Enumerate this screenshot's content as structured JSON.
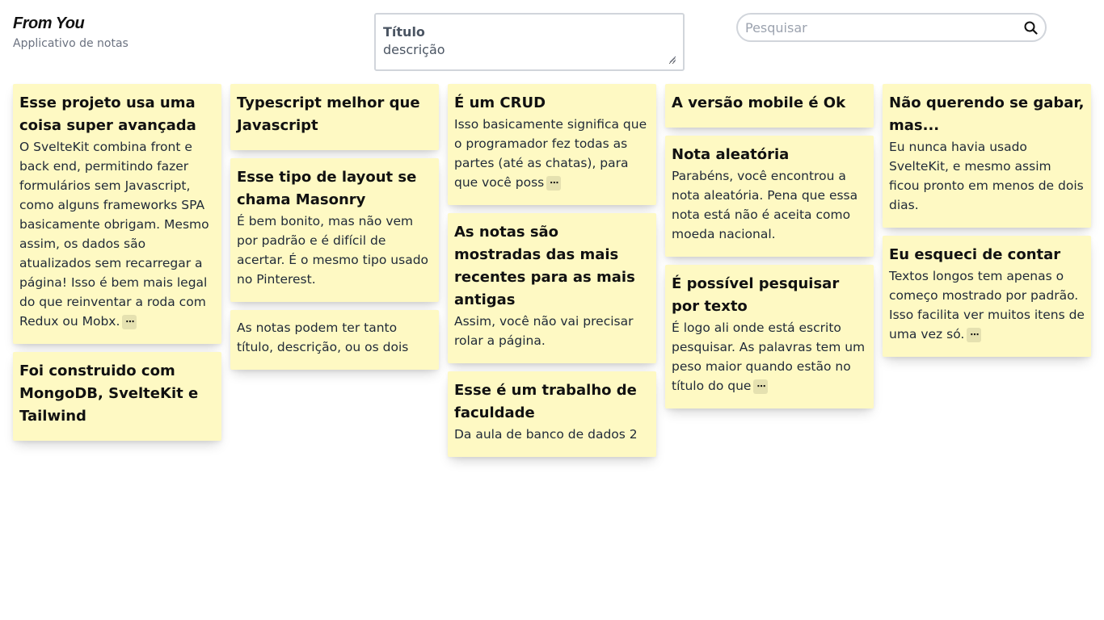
{
  "brand": {
    "title": "From You",
    "subtitle": "Applicativo de notas"
  },
  "composer": {
    "title_placeholder": "Título",
    "desc_placeholder": "descrição"
  },
  "search": {
    "placeholder": "Pesquisar",
    "icon": "search-icon"
  },
  "more_label": "⋯",
  "columns": [
    [
      {
        "title": "Esse projeto usa uma coisa super avançada",
        "desc": "O SvelteKit combina front e back end, permitindo fazer formulários sem Javascript, como alguns frameworks SPA basicamente obrigam. Mesmo assim, os dados são atualizados sem recarregar a página! Isso é bem mais legal do que reinventar a roda com Redux ou Mobx.",
        "truncated": true
      },
      {
        "title": "Foi construido com MongoDB, SvelteKit e Tailwind",
        "desc": "",
        "truncated": false
      }
    ],
    [
      {
        "title": "Typescript melhor que Javascript",
        "desc": "",
        "truncated": false
      },
      {
        "title": "Esse tipo de layout se chama Masonry",
        "desc": "É bem bonito, mas não vem por padrão e é difícil de acertar. É o mesmo tipo usado no Pinterest.",
        "truncated": false
      },
      {
        "title": "",
        "desc": "As notas podem ter tanto título, descrição, ou os dois",
        "truncated": false
      }
    ],
    [
      {
        "title": "É um CRUD",
        "desc": "Isso basicamente significa que o programador fez todas as partes (até as chatas), para que você poss",
        "truncated": true
      },
      {
        "title": "As notas são mostradas das mais recentes para as mais antigas",
        "desc": "Assim, você não vai precisar rolar a página.",
        "truncated": false
      },
      {
        "title": "Esse é um trabalho de faculdade",
        "desc": "Da aula de banco de dados 2",
        "truncated": false
      }
    ],
    [
      {
        "title": "A versão mobile é Ok",
        "desc": "",
        "truncated": false
      },
      {
        "title": "Nota aleatória",
        "desc": "Parabéns, você encontrou a nota aleatória. Pena que essa nota está não é aceita como moeda nacional.",
        "truncated": false
      },
      {
        "title": "É possível pesquisar por texto",
        "desc": "É logo ali onde está escrito pesquisar. As palavras tem um peso maior quando estão no título do que",
        "truncated": true
      }
    ],
    [
      {
        "title": "Não querendo se gabar, mas...",
        "desc": "Eu nunca havia usado SvelteKit, e mesmo assim ficou pronto em menos de dois dias.",
        "truncated": false
      },
      {
        "title": "Eu esqueci de contar",
        "desc": "Textos longos tem apenas o começo mostrado por padrão. Isso facilita ver muitos itens de uma vez só.",
        "truncated": true
      }
    ]
  ],
  "colors": {
    "note_bg": "#fef9c3",
    "more_bg": "#e5e1b0",
    "border": "#d1d5db"
  }
}
